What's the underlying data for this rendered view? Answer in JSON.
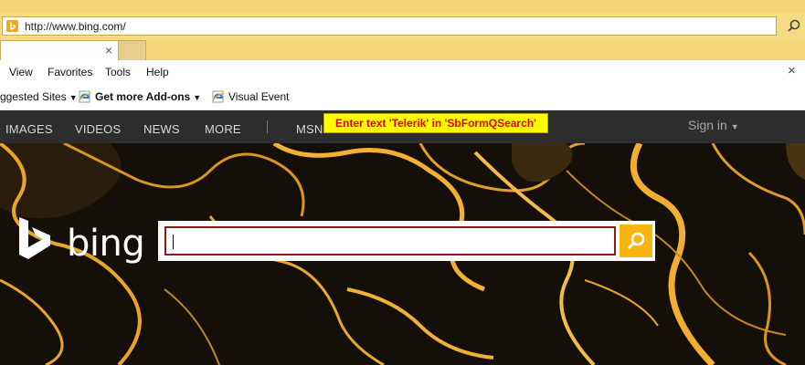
{
  "browser": {
    "url_prefix": "http://www.",
    "url_domain": "bing.com",
    "url_suffix": "/",
    "tab_close": "×",
    "address_search_glyph": "search-icon"
  },
  "menu": {
    "items": [
      "View",
      "Favorites",
      "Tools",
      "Help"
    ],
    "close": "×"
  },
  "favorites_bar": {
    "suggested": "ggested Sites",
    "addons": "Get more Add-ons",
    "visual_event": "Visual Event"
  },
  "bing_nav": {
    "items": [
      "IMAGES",
      "VIDEOS",
      "NEWS",
      "MORE",
      "MSN"
    ],
    "sign_in": "Sign in"
  },
  "tooltip": {
    "text": "Enter text 'Telerik' in 'SbFormQSearch'"
  },
  "bing": {
    "logo_text": "bing",
    "search_value": "",
    "search_button_icon": "magnifier-icon"
  },
  "colors": {
    "bing_yellow": "#f8b40f",
    "nav_bg": "#2d2d2d",
    "focus_border": "#8b1a1a",
    "tooltip_bg": "#fffb00",
    "tooltip_text": "#e00000"
  }
}
